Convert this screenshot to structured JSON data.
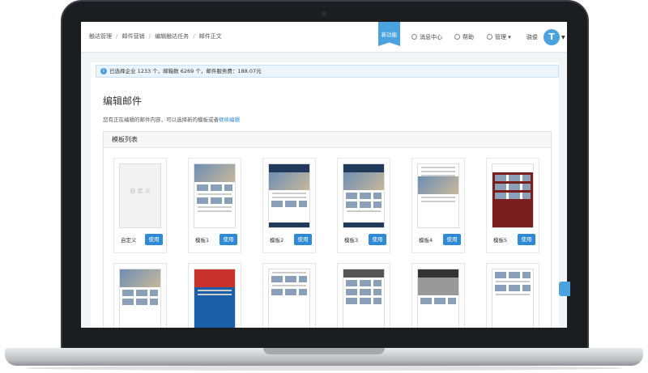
{
  "breadcrumb": [
    "触达管理",
    "邮件营销",
    "编辑触达任务",
    "邮件正文"
  ],
  "header": {
    "new_badge": "新功能",
    "messages": "消息中心",
    "help": "帮助",
    "manage": "管理",
    "user": "骁俊",
    "avatar": "T"
  },
  "alert": {
    "text": "已选择企业 1233 个，邮箱数 6269 个，邮件服务费：188.07元"
  },
  "page": {
    "title": "编辑邮件",
    "desc_prefix": "您有正在编辑的邮件内容，可以选择新的模板或者",
    "desc_link": "继续编辑"
  },
  "panel": {
    "title": "模板列表"
  },
  "templates": [
    {
      "label": "自定义",
      "use": "使用",
      "blank_text": "自 定 义"
    },
    {
      "label": "模板1",
      "use": "使用"
    },
    {
      "label": "模板2",
      "use": "使用"
    },
    {
      "label": "模板3",
      "use": "使用"
    },
    {
      "label": "模板4",
      "use": "使用"
    },
    {
      "label": "模板5",
      "use": "使用"
    }
  ],
  "colors": {
    "accent": "#2e8ad6",
    "badge": "#4aa3df"
  }
}
